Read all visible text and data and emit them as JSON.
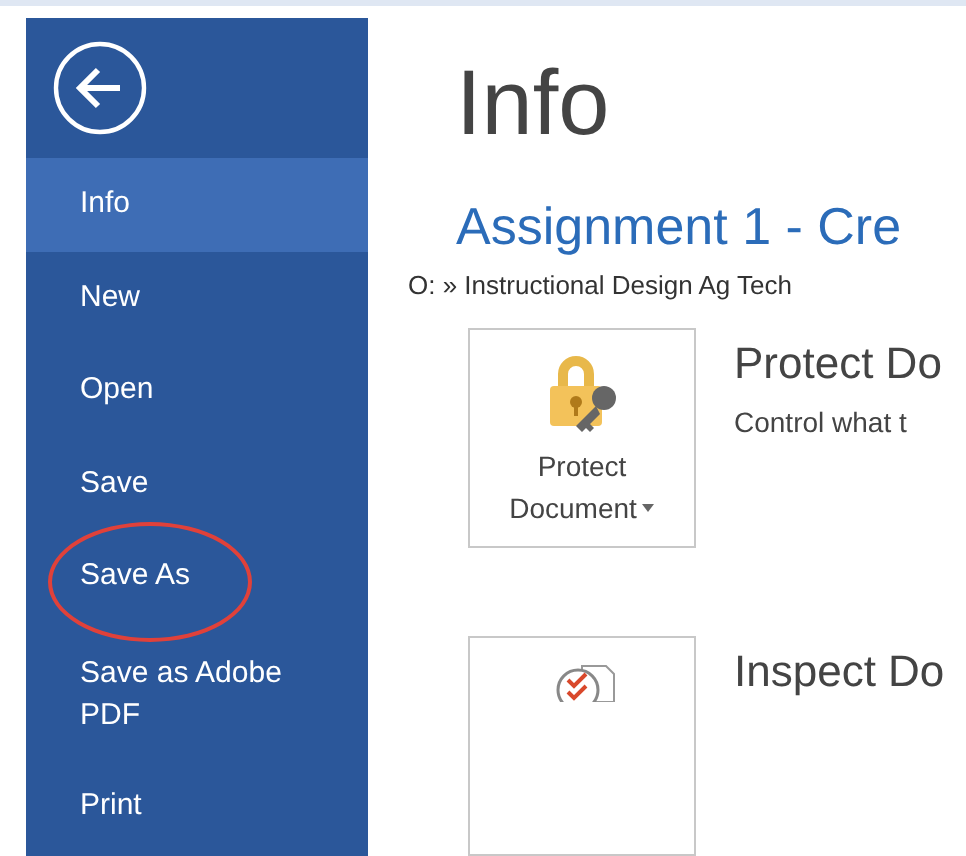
{
  "sidebar": {
    "items": [
      {
        "label": "Info",
        "selected": true,
        "circled": false
      },
      {
        "label": "New",
        "selected": false,
        "circled": false
      },
      {
        "label": "Open",
        "selected": false,
        "circled": false
      },
      {
        "label": "Save",
        "selected": false,
        "circled": false
      },
      {
        "label": "Save As",
        "selected": false,
        "circled": true
      },
      {
        "label": "Save as Adobe PDF",
        "selected": false,
        "circled": false
      },
      {
        "label": "Print",
        "selected": false,
        "circled": false
      }
    ]
  },
  "page_title": "Info",
  "document_title": "Assignment 1 -  Cre",
  "document_path": "O: » Instructional Design Ag Tech",
  "sections": [
    {
      "kind": "protect",
      "button_label": "Protect Document",
      "heading": "Protect Do",
      "description": "Control what t"
    },
    {
      "kind": "inspect",
      "heading": "Inspect Do"
    }
  ]
}
